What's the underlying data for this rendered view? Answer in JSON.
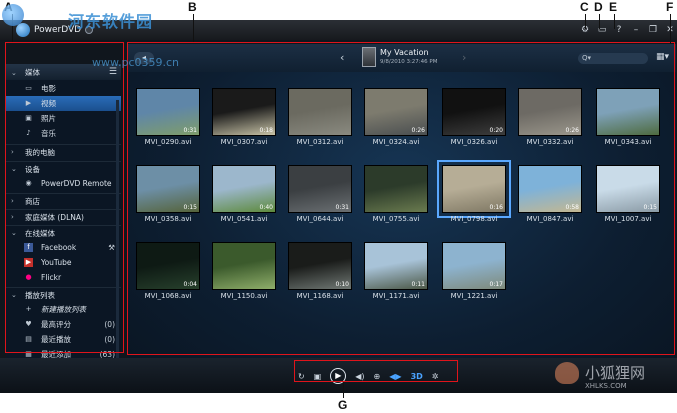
{
  "window": {
    "title": "PowerDVD",
    "controls": [
      "⚙",
      "▭",
      "?",
      "–",
      "❐",
      "✕"
    ]
  },
  "sidebar": {
    "section_label": "媒体",
    "items": [
      {
        "label": "电影",
        "icon": "film-icon"
      },
      {
        "label": "视频",
        "icon": "video-icon",
        "active": true
      },
      {
        "label": "照片",
        "icon": "photo-icon"
      },
      {
        "label": "音乐",
        "icon": "music-icon"
      }
    ],
    "categories": [
      {
        "label": "我的电脑"
      },
      {
        "label": "设备"
      },
      {
        "label": "PowerDVD Remote"
      },
      {
        "label": "商店"
      },
      {
        "label": "家庭媒体 (DLNA)"
      },
      {
        "label": "在线媒体"
      },
      {
        "label": "Facebook"
      },
      {
        "label": "YouTube"
      },
      {
        "label": "Flickr"
      },
      {
        "label": "播放列表"
      },
      {
        "label": "新建播放列表"
      },
      {
        "label": "最高评分",
        "count": "(0)"
      },
      {
        "label": "最近播放",
        "count": "(0)"
      },
      {
        "label": "最近添加",
        "count": "(63)"
      }
    ]
  },
  "navbar": {
    "album_title": "My Vacation",
    "album_date": "9/8/2010 3:27:46 PM",
    "search_placeholder": "Q▾"
  },
  "videos": [
    {
      "name": "MVI_0290.avi",
      "duration": "0:31",
      "colors": [
        "#5f86a8",
        "#7f9d6a"
      ]
    },
    {
      "name": "MVI_0307.avi",
      "duration": "0:18",
      "colors": [
        "#1a1a1a",
        "#c7c2a6"
      ]
    },
    {
      "name": "MVI_0312.avi",
      "duration": "",
      "colors": [
        "#6b6a60",
        "#8a8a80"
      ]
    },
    {
      "name": "MVI_0324.avi",
      "duration": "0:26",
      "colors": [
        "#7d7b6e",
        "#4a4e50"
      ]
    },
    {
      "name": "MVI_0326.avi",
      "duration": "0:20",
      "colors": [
        "#111111",
        "#3d3d3d"
      ]
    },
    {
      "name": "MVI_0332.avi",
      "duration": "0:26",
      "colors": [
        "#6d6a64",
        "#9a968b"
      ]
    },
    {
      "name": "MVI_0343.avi",
      "duration": "",
      "colors": [
        "#7ea1b8",
        "#4e6b3f"
      ]
    },
    {
      "name": "MVI_0358.avi",
      "duration": "0:15",
      "colors": [
        "#6d8fa6",
        "#55633a"
      ]
    },
    {
      "name": "MVI_0541.avi",
      "duration": "0:40",
      "colors": [
        "#9cb7cc",
        "#5d8a3c"
      ]
    },
    {
      "name": "MVI_0644.avi",
      "duration": "0:31",
      "colors": [
        "#3b3f42",
        "#6a6f72"
      ]
    },
    {
      "name": "MVI_0755.avi",
      "duration": "",
      "colors": [
        "#2c3b2a",
        "#6a7b4f"
      ]
    },
    {
      "name": "MVI_0798.avi",
      "duration": "0:16",
      "colors": [
        "#b6ad96",
        "#7f7864"
      ],
      "selected": true
    },
    {
      "name": "MVI_0847.avi",
      "duration": "0:58",
      "colors": [
        "#7eb2d9",
        "#c3b791"
      ]
    },
    {
      "name": "MVI_1007.avi",
      "duration": "0:15",
      "colors": [
        "#c9dbe8",
        "#8a9aa5"
      ]
    },
    {
      "name": "MVI_1068.avi",
      "duration": "0:04",
      "colors": [
        "#0e1a14",
        "#27402c"
      ]
    },
    {
      "name": "MVI_1150.avi",
      "duration": "",
      "colors": [
        "#3b5a2c",
        "#8fae6a"
      ]
    },
    {
      "name": "MVI_1168.avi",
      "duration": "0:10",
      "colors": [
        "#1a1c1a",
        "#707874"
      ]
    },
    {
      "name": "MVI_1171.avi",
      "duration": "0:11",
      "colors": [
        "#a8c3d8",
        "#4c5847"
      ]
    },
    {
      "name": "MVI_1221.avi",
      "duration": "0:17",
      "colors": [
        "#8db3cf",
        "#7e8a7b"
      ]
    }
  ],
  "playback": {
    "three_d_label": "3D"
  },
  "callouts": [
    "A",
    "B",
    "C",
    "D",
    "E",
    "F",
    "G"
  ],
  "watermarks": {
    "top_text": "河东软件园",
    "top_url": "www.pc0359.cn",
    "bottom_text": "小狐狸网",
    "bottom_url": "XHLKS.COM"
  }
}
